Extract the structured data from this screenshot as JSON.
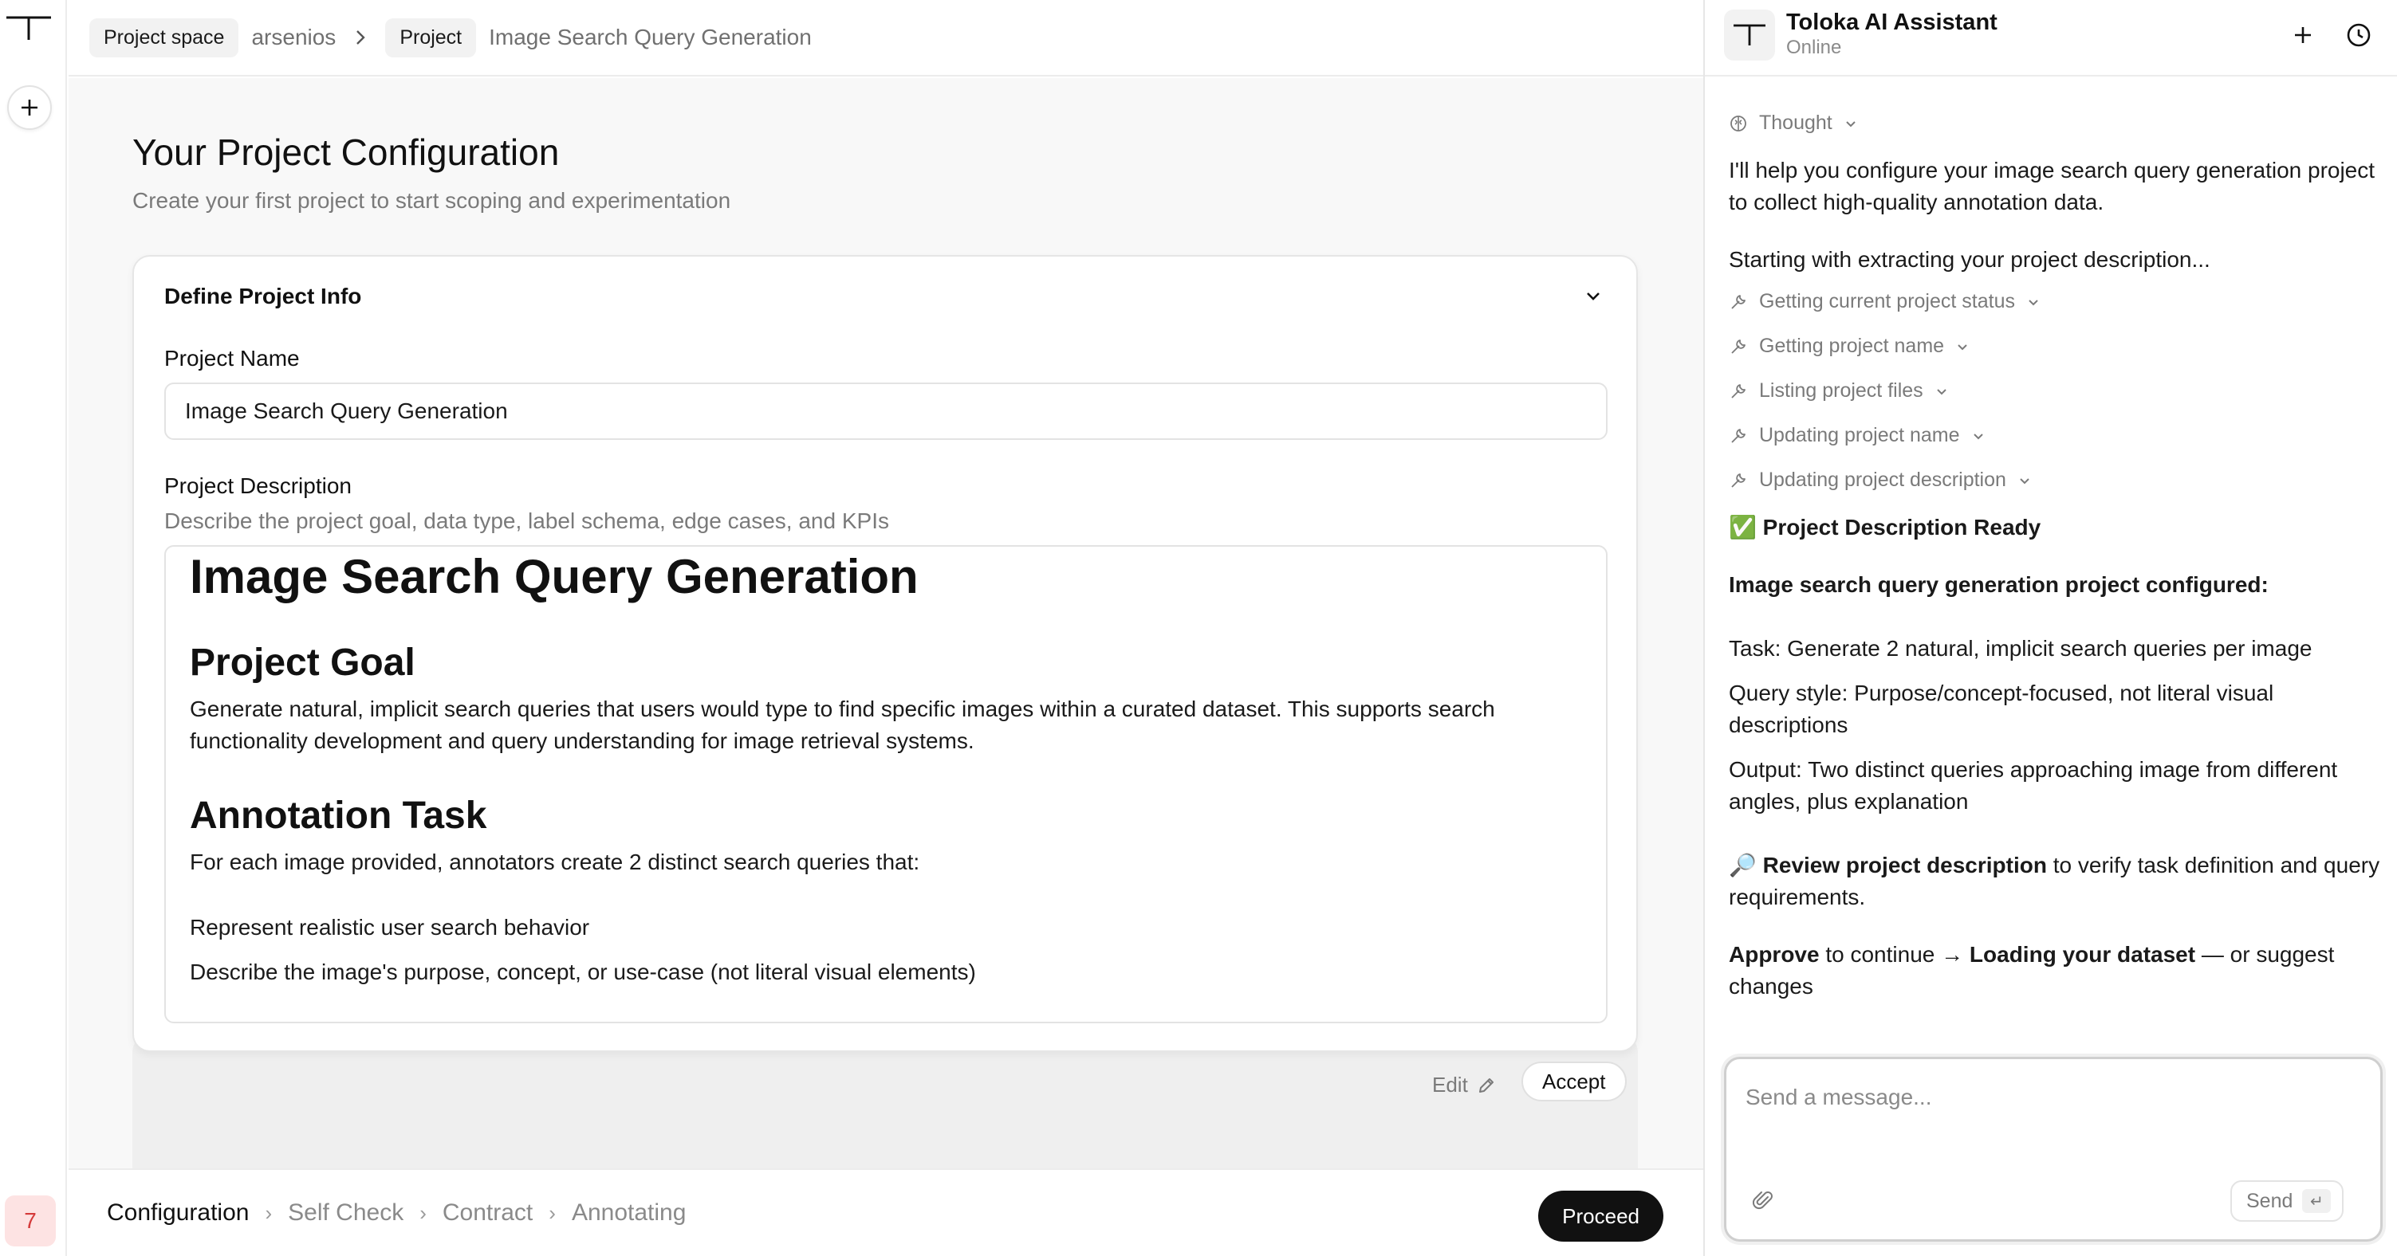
{
  "breadcrumb": {
    "items": [
      "Project space",
      "arsenios",
      "Project",
      "Image Search Query Generation"
    ]
  },
  "page": {
    "title": "Your Project Configuration",
    "subtitle": "Create your first project to start scoping and experimentation"
  },
  "card": {
    "heading": "Define Project Info",
    "name_label": "Project Name",
    "name_value": "Image Search Query Generation",
    "description_label": "Project Description",
    "description_hint": "Describe the project goal, data type, label schema, edge cases, and KPIs",
    "description": {
      "h1": "Image Search Query Generation",
      "goal_heading": "Project Goal",
      "goal_text": "Generate natural, implicit search queries that users would type to find specific images within a curated dataset. This supports search functionality development and query understanding for image retrieval systems.",
      "task_heading": "Annotation Task",
      "task_intro": "For each image provided, annotators create 2 distinct search queries that:",
      "task_items": [
        "Represent realistic user search behavior",
        "Describe the image's purpose, concept, or use-case (not literal visual elements)"
      ]
    },
    "edit_label": "Edit",
    "accept_label": "Accept"
  },
  "stepper": {
    "steps": [
      "Configuration",
      "Self Check",
      "Contract",
      "Annotating"
    ],
    "proceed_label": "Proceed"
  },
  "rail": {
    "badge": "7"
  },
  "assistant": {
    "name": "Toloka AI Assistant",
    "status": "Online",
    "thought_label": "Thought",
    "intro": "I'll help you configure your image search query generation project to collect high-quality annotation data.",
    "starting": "Starting with extracting your project description...",
    "tools": [
      "Getting current project status",
      "Getting project name",
      "Listing project files",
      "Updating project name",
      "Updating project description"
    ],
    "ready_emoji": "✅",
    "ready_title": "Project Description Ready",
    "configured": "Image search query generation project configured:",
    "task_line": "Task: Generate 2 natural, implicit search queries per image",
    "style_line": "Query style: Purpose/concept-focused, not literal visual descriptions",
    "output_line": "Output: Two distinct queries approaching image from different angles, plus explanation",
    "review_emoji": "🔎",
    "review_bold": "Review project description",
    "review_rest": " to verify task definition and query requirements.",
    "approve_bold": "Approve",
    "approve_mid": " to continue → ",
    "approve_bold2": "Loading your dataset",
    "approve_rest": " — or suggest changes",
    "input_placeholder": "Send a message...",
    "send_label": "Send",
    "enter_glyph": "↵"
  }
}
